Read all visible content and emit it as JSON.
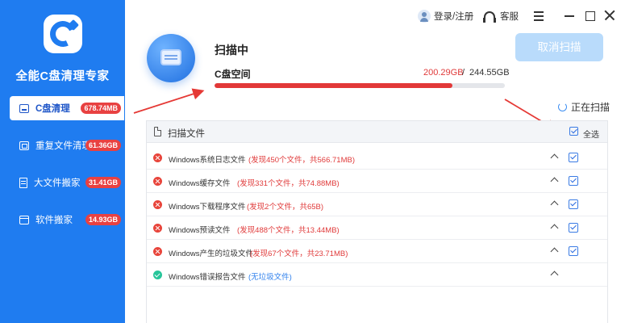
{
  "app": {
    "title": "全能C盘清理专家"
  },
  "sidebar": {
    "items": [
      {
        "label": "C盘清理",
        "badge": "678.74MB",
        "icon": "drive-icon",
        "active": true
      },
      {
        "label": "重复文件清理",
        "badge": "61.36GB",
        "icon": "duplicate-icon",
        "active": false
      },
      {
        "label": "大文件搬家",
        "badge": "31.41GB",
        "icon": "file-icon",
        "active": false
      },
      {
        "label": "软件搬家",
        "badge": "14.93GB",
        "icon": "software-icon",
        "active": false
      }
    ]
  },
  "topbar": {
    "login_label": "登录/注册",
    "service_label": "客服"
  },
  "scan": {
    "title": "扫描中",
    "space_label": "C盘空间",
    "used": "200.29GB",
    "separator": "/",
    "total": "244.55GB",
    "used_fraction": 0.819,
    "cancel_label": "取消扫描",
    "status": "正在扫描"
  },
  "file_list": {
    "header": "扫描文件",
    "select_all_label": "全选",
    "rows": [
      {
        "name": "Windows系统日志文件",
        "detail": "(发现450个文件，共566.71MB)",
        "status": "error",
        "checked": true
      },
      {
        "name": "Windows缓存文件",
        "detail": "(发现331个文件，共74.88MB)",
        "status": "error",
        "checked": true
      },
      {
        "name": "Windows下载程序文件",
        "detail": "(发现2个文件，共65B)",
        "status": "error",
        "checked": true
      },
      {
        "name": "Windows预读文件",
        "detail": "(发现488个文件，共13.44MB)",
        "status": "error",
        "checked": true
      },
      {
        "name": "Windows产生的垃圾文件",
        "detail": "(发现67个文件，共23.71MB)",
        "status": "error",
        "checked": true
      },
      {
        "name": "Windows错误报告文件",
        "detail": "(无垃圾文件)",
        "status": "ok",
        "checked": false
      }
    ]
  },
  "colors": {
    "sidebar_blue": "#1f7cf0",
    "badge_red": "#e84141",
    "progress_red": "#e23838",
    "cancel_button": "#b9dbfb"
  }
}
